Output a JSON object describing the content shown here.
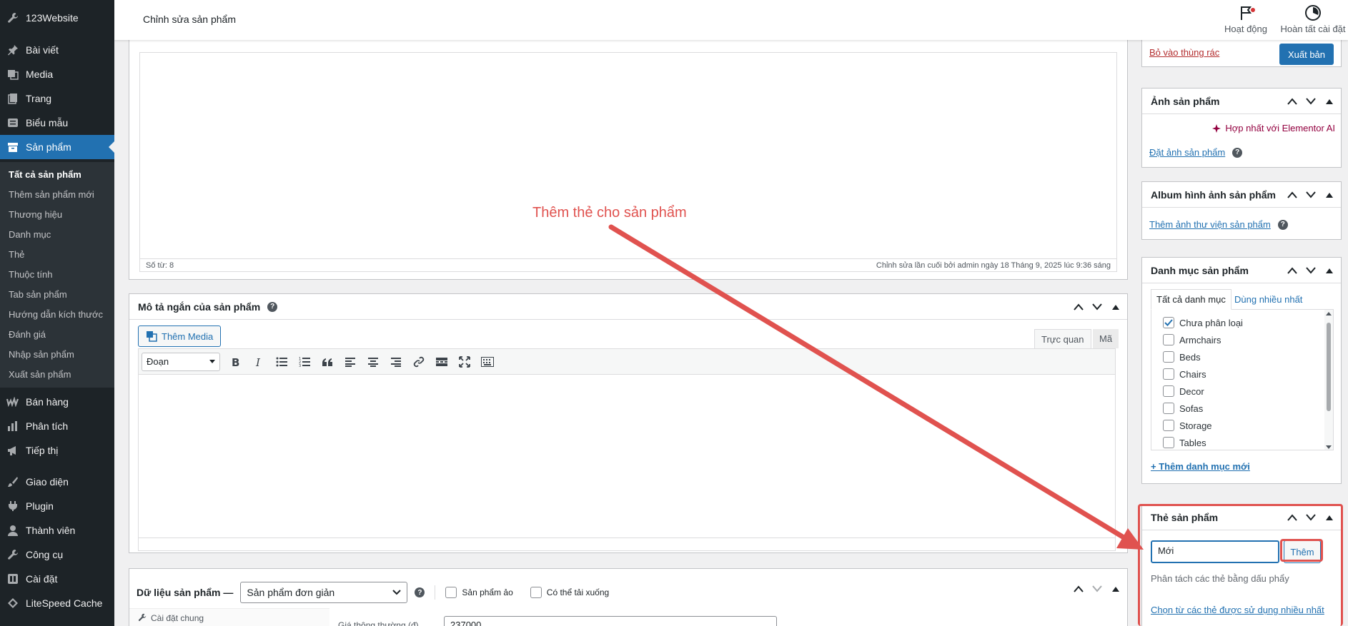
{
  "sidebar": {
    "site": "123Website",
    "items": [
      {
        "label": "Bài viết",
        "icon": "pin-icon"
      },
      {
        "label": "Media",
        "icon": "media-icon"
      },
      {
        "label": "Trang",
        "icon": "page-icon"
      },
      {
        "label": "Biểu mẫu",
        "icon": "form-icon"
      },
      {
        "label": "Sản phẩm",
        "icon": "archive-icon"
      },
      {
        "label": "Bán hàng",
        "icon": "woo-icon"
      },
      {
        "label": "Phân tích",
        "icon": "chart-icon"
      },
      {
        "label": "Tiếp thị",
        "icon": "megaphone-icon"
      },
      {
        "label": "Giao diện",
        "icon": "brush-icon"
      },
      {
        "label": "Plugin",
        "icon": "plugin-icon"
      },
      {
        "label": "Thành viên",
        "icon": "user-icon"
      },
      {
        "label": "Công cụ",
        "icon": "wrench-icon"
      },
      {
        "label": "Cài đặt",
        "icon": "settings-icon"
      },
      {
        "label": "LiteSpeed Cache",
        "icon": "diamond-icon"
      }
    ],
    "submenu": [
      "Tất cả sản phẩm",
      "Thêm sản phẩm mới",
      "Thương hiệu",
      "Danh mục",
      "Thẻ",
      "Thuộc tính",
      "Tab sản phẩm",
      "Hướng dẫn kích thước",
      "Đánh giá",
      "Nhập sản phẩm",
      "Xuất sản phẩm"
    ]
  },
  "header": {
    "title": "Chỉnh sửa sản phẩm",
    "activity": "Hoạt động",
    "finish_setup": "Hoàn tất cài đặt"
  },
  "editor": {
    "word_count": "Số từ: 8",
    "last_edit": "Chỉnh sửa lần cuối bởi admin ngày 18 Tháng 9, 2025 lúc 9:36 sáng"
  },
  "short_desc": {
    "title": "Mô tả ngắn của sản phẩm",
    "add_media": "Thêm Media",
    "tab_visual": "Trực quan",
    "tab_code": "Mã",
    "format": "Đoạn"
  },
  "product_data": {
    "title": "Dữ liệu sản phẩm —",
    "type": "Sản phẩm đơn giản",
    "virtual": "Sản phẩm ảo",
    "downloadable": "Có thể tải xuống",
    "general_tab": "Cài đặt chung",
    "price_label": "Giá thông thường (đ)",
    "price_value": "237000"
  },
  "publish": {
    "trash": "Bỏ vào thùng rác",
    "publish_btn": "Xuất bản"
  },
  "product_image": {
    "title": "Ảnh sản phẩm",
    "elementor": "Hợp nhất với Elementor AI",
    "set_image": "Đặt ảnh sản phẩm"
  },
  "gallery": {
    "title": "Album hình ảnh sản phẩm",
    "add": "Thêm ảnh thư viện sản phẩm"
  },
  "categories": {
    "title": "Danh mục sản phẩm",
    "tab_all": "Tất cả danh mục",
    "tab_popular": "Dùng nhiều nhất",
    "items": [
      {
        "label": "Chưa phân loại",
        "checked": true
      },
      {
        "label": "Armchairs",
        "checked": false
      },
      {
        "label": "Beds",
        "checked": false
      },
      {
        "label": "Chairs",
        "checked": false
      },
      {
        "label": "Decor",
        "checked": false
      },
      {
        "label": "Sofas",
        "checked": false
      },
      {
        "label": "Storage",
        "checked": false
      },
      {
        "label": "Tables",
        "checked": false
      }
    ],
    "add_new": "+ Thêm danh mục mới"
  },
  "tags": {
    "title": "Thẻ sản phẩm",
    "input_value": "Mới",
    "add_btn": "Thêm",
    "hint": "Phân tách các thẻ bằng dấu phẩy",
    "choose": "Chọn từ các thẻ được sử dụng nhiều nhất"
  },
  "annotation": {
    "text": "Thêm thẻ cho sản phẩm",
    "color": "#e0524f"
  },
  "colors": {
    "accent": "#2271b1",
    "sidebar": "#1d2327",
    "highlight": "#e0524f"
  }
}
